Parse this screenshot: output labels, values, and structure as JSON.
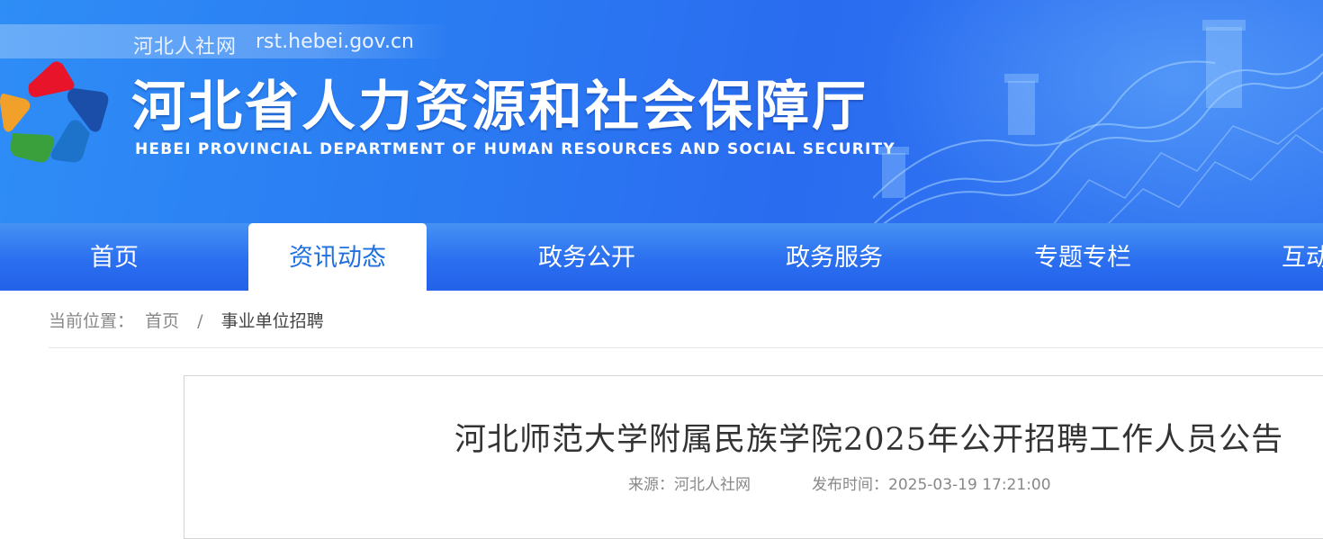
{
  "header": {
    "site_name": "河北人社网",
    "site_url": "rst.hebei.gov.cn",
    "org_name_cn": "河北省人力资源和社会保障厅",
    "org_name_en": "HEBEI PROVINCIAL DEPARTMENT OF HUMAN RESOURCES AND SOCIAL SECURITY",
    "logo_icon": "pentagon-logo-icon",
    "colors": {
      "banner_blue": "#2a7df2",
      "nav_blue": "#2b6ff0",
      "active_text": "#1f6fe0"
    }
  },
  "nav": {
    "items": [
      {
        "label": "首页",
        "active": false
      },
      {
        "label": "资讯动态",
        "active": true
      },
      {
        "label": "政务公开",
        "active": false
      },
      {
        "label": "政务服务",
        "active": false
      },
      {
        "label": "专题专栏",
        "active": false
      },
      {
        "label": "互动",
        "active": false
      }
    ]
  },
  "breadcrumb": {
    "prefix": "当前位置：",
    "home": "首页",
    "separator": "/",
    "current": "事业单位招聘"
  },
  "article": {
    "title": "河北师范大学附属民族学院2025年公开招聘工作人员公告",
    "source": "来源：河北人社网",
    "published": "发布时间：2025-03-19 17:21:00"
  }
}
